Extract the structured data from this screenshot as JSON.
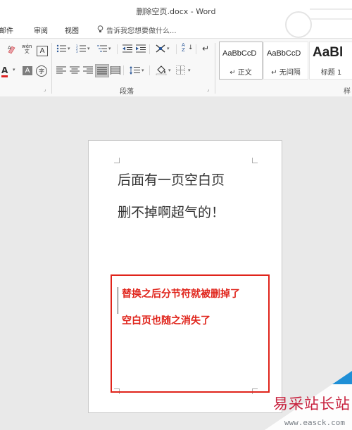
{
  "window": {
    "title": "删除空页.docx - Word"
  },
  "tabs": [
    {
      "label": "邮件"
    },
    {
      "label": "审阅"
    },
    {
      "label": "视图"
    }
  ],
  "tellme": {
    "text": "告诉我您想要做什么..."
  },
  "ribbon": {
    "font_group": {
      "wen_label": "wén\n文",
      "a_box": "A",
      "a_color": "A",
      "a_shade": "A",
      "circled": "字"
    },
    "paragraph_group": {
      "label": "段落",
      "sort_label": "A\nZ",
      "para_mark": "↵"
    },
    "styles": [
      {
        "preview": "AaBbCcD",
        "name": "↵ 正文",
        "selected": true
      },
      {
        "preview": "AaBbCcD",
        "name": "↵ 无间隔",
        "selected": false
      },
      {
        "preview": "AaBl",
        "name": "标题 1",
        "selected": false
      }
    ],
    "styles_group_label": "样"
  },
  "document": {
    "lines": [
      "后面有一页空白页",
      "删不掉啊超气的！"
    ],
    "annotation_lines": [
      "替换之后分节符就被删掉了",
      "空白页也随之消失了"
    ]
  },
  "watermark": {
    "text": "易采站长站",
    "url": "www.easck.com"
  },
  "colors": {
    "annotation_red": "#e0241b",
    "ribbon_bg": "#f8f8f8",
    "doc_bg": "#e9e9e9"
  }
}
